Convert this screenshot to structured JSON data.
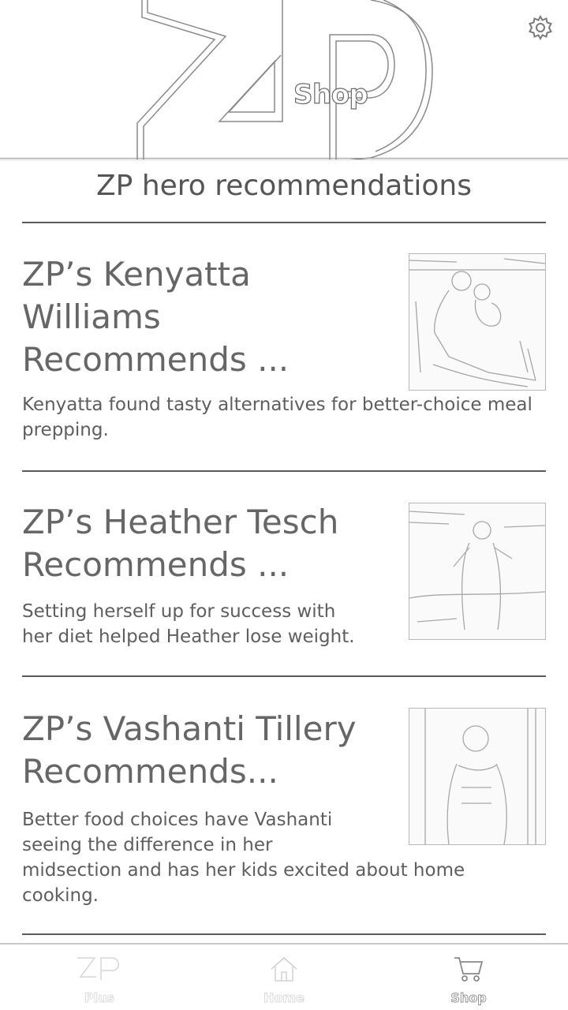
{
  "header": {
    "logo_text": "ZP",
    "logo_sub": "Shop",
    "settings_icon": "gear-icon"
  },
  "section": {
    "title": "ZP hero recommendations"
  },
  "cards": [
    {
      "title_lines": [
        "ZP’s Kenyatta",
        "Williams",
        "Recommends ..."
      ],
      "desc_lines": [
        "Kenyatta found tasty alternatives for better-choice meal",
        "prepping."
      ],
      "image_alt": "photo of woman with child sitting on floor"
    },
    {
      "title_lines": [
        "ZP’s Heather Tesch",
        "Recommends ..."
      ],
      "desc_lines": [
        "Setting herself up for success with",
        "her diet helped Heather lose weight."
      ],
      "image_alt": "photo of woman outdoors"
    },
    {
      "title_lines": [
        "ZP’s Vashanti Tillery",
        "Recommends..."
      ],
      "desc_lines": [
        "Better food choices have Vashanti",
        "seeing the difference in her",
        "midsection and has her kids excited about home",
        "cooking."
      ],
      "image_alt": "photo of woman smiling"
    }
  ],
  "nav": {
    "items": [
      {
        "label": "Plus",
        "icon": "zp-plus-icon",
        "active": false
      },
      {
        "label": "Home",
        "icon": "home-icon",
        "active": false
      },
      {
        "label": "Shop",
        "icon": "cart-icon",
        "active": true
      }
    ]
  }
}
